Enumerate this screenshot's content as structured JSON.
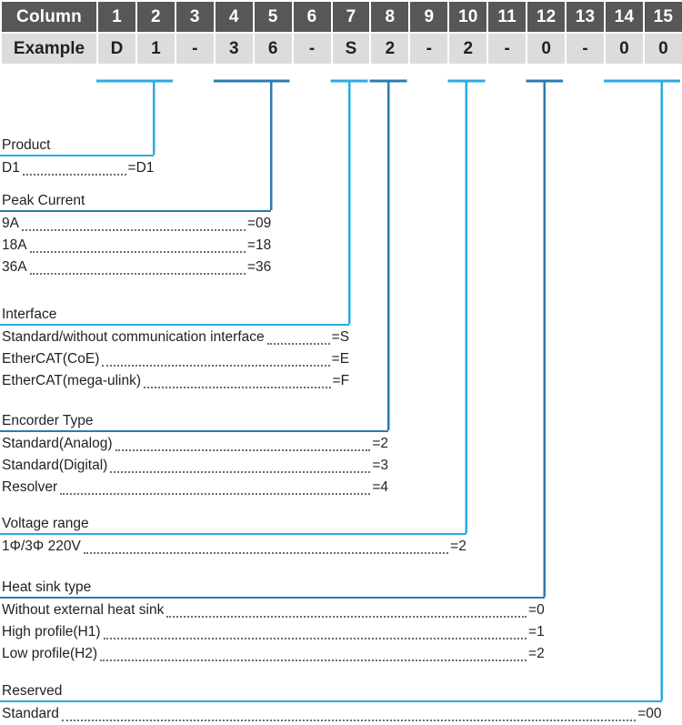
{
  "table": {
    "row_labels": [
      "Column",
      "Example"
    ],
    "columns": [
      "1",
      "2",
      "3",
      "4",
      "5",
      "6",
      "7",
      "8",
      "9",
      "10",
      "11",
      "12",
      "13",
      "14",
      "15"
    ],
    "example": [
      "D",
      "1",
      "-",
      "3",
      "6",
      "-",
      "S",
      "2",
      "-",
      "2",
      "-",
      "0",
      "-",
      "0",
      "0"
    ]
  },
  "colors": {
    "cyan": "#29abe2",
    "steel_blue": "#2b7cb0",
    "header_bg": "#575757",
    "row_bg": "#dcdcdc",
    "text": "#231f20"
  },
  "sections": [
    {
      "title": "Product",
      "accent": "cyan",
      "options": [
        {
          "label": "D1",
          "value": "=D1"
        }
      ]
    },
    {
      "title": "Peak Current",
      "accent": "steel_blue",
      "options": [
        {
          "label": "9A",
          "value": "=09"
        },
        {
          "label": "18A",
          "value": "=18"
        },
        {
          "label": "36A",
          "value": "=36"
        }
      ]
    },
    {
      "title": "Interface",
      "accent": "cyan",
      "options": [
        {
          "label": "Standard/without communication interface",
          "value": "=S"
        },
        {
          "label": "EtherCAT(CoE)",
          "value": "=E"
        },
        {
          "label": "EtherCAT(mega-ulink)",
          "value": "=F"
        }
      ]
    },
    {
      "title": "Encorder Type",
      "accent": "steel_blue",
      "options": [
        {
          "label": "Standard(Analog)",
          "value": "=2"
        },
        {
          "label": "Standard(Digital)",
          "value": "=3"
        },
        {
          "label": "Resolver",
          "value": "=4"
        }
      ]
    },
    {
      "title": "Voltage range",
      "accent": "cyan",
      "options": [
        {
          "label": "1Φ/3Φ 220V",
          "value": "=2"
        }
      ]
    },
    {
      "title": "Heat sink type",
      "accent": "steel_blue",
      "options": [
        {
          "label": "Without external heat sink",
          "value": "=0"
        },
        {
          "label": "High profile(H1)",
          "value": "=1"
        },
        {
          "label": "Low profile(H2)",
          "value": "=2"
        }
      ]
    },
    {
      "title": "Reserved",
      "accent": "cyan",
      "options": [
        {
          "label": "Standard",
          "value": "=00"
        }
      ]
    }
  ]
}
